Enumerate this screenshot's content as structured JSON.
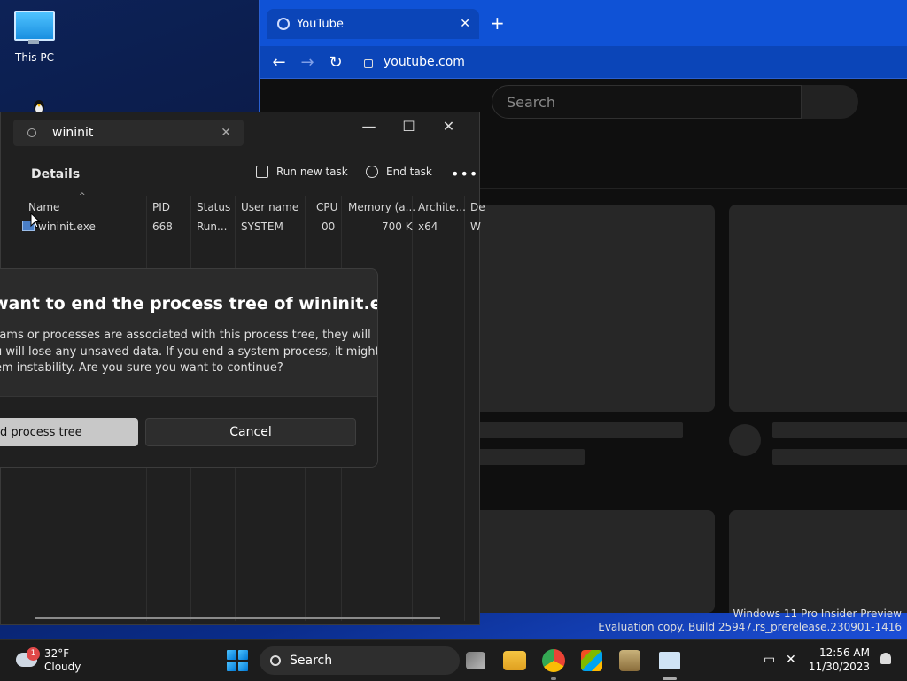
{
  "desktop": {
    "this_pc_label": "This PC",
    "watermark_line1": "Windows 11 Pro Insider Preview",
    "watermark_line2": "Evaluation copy. Build 25947.rs_prerelease.230901-1416"
  },
  "browser": {
    "tab_title": "YouTube",
    "tab_close": "✕",
    "new_tab": "+",
    "back": "←",
    "forward": "→",
    "reload": "↻",
    "url": "youtube.com",
    "search_placeholder": "Search"
  },
  "task_manager": {
    "search_value": "wininit",
    "search_clear": "✕",
    "minimize": "—",
    "maximize": "☐",
    "close": "✕",
    "page_title": "Details",
    "run_new_task": "Run new task",
    "end_task": "End task",
    "more": "•••",
    "columns": [
      "Name",
      "PID",
      "Status",
      "User name",
      "CPU",
      "Memory (a...",
      "Archite...",
      "De"
    ],
    "row": {
      "name": "wininit.exe",
      "pid": "668",
      "status": "Run...",
      "user": "SYSTEM",
      "cpu": "00",
      "memory": "700 K",
      "arch": "x64",
      "desc": "W"
    }
  },
  "dialog": {
    "title": "want to end the process tree of wininit.exe?",
    "body": "rams or processes are associated with this process tree, they will\nu will lose any unsaved data. If you end a system process, it might\nem instability. Are you sure you want to continue?",
    "primary_label": "d process tree",
    "cancel_label": "Cancel"
  },
  "taskbar": {
    "weather_badge": "1",
    "temperature": "32°F",
    "condition": "Cloudy",
    "search_label": "Search",
    "time": "12:56 AM",
    "date": "11/30/2023"
  }
}
